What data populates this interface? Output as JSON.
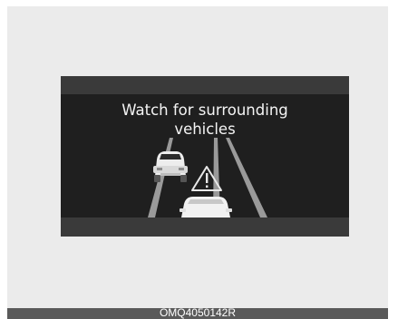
{
  "display": {
    "message_line1": "Watch for surrounding",
    "message_line2": "vehicles",
    "warning_icon": "warning-triangle-icon",
    "colors": {
      "screen": "#1f1f1f",
      "band": "#3a3a3a",
      "text": "#f4f4f4"
    }
  },
  "caption": {
    "code": "OMQ4050142R"
  }
}
